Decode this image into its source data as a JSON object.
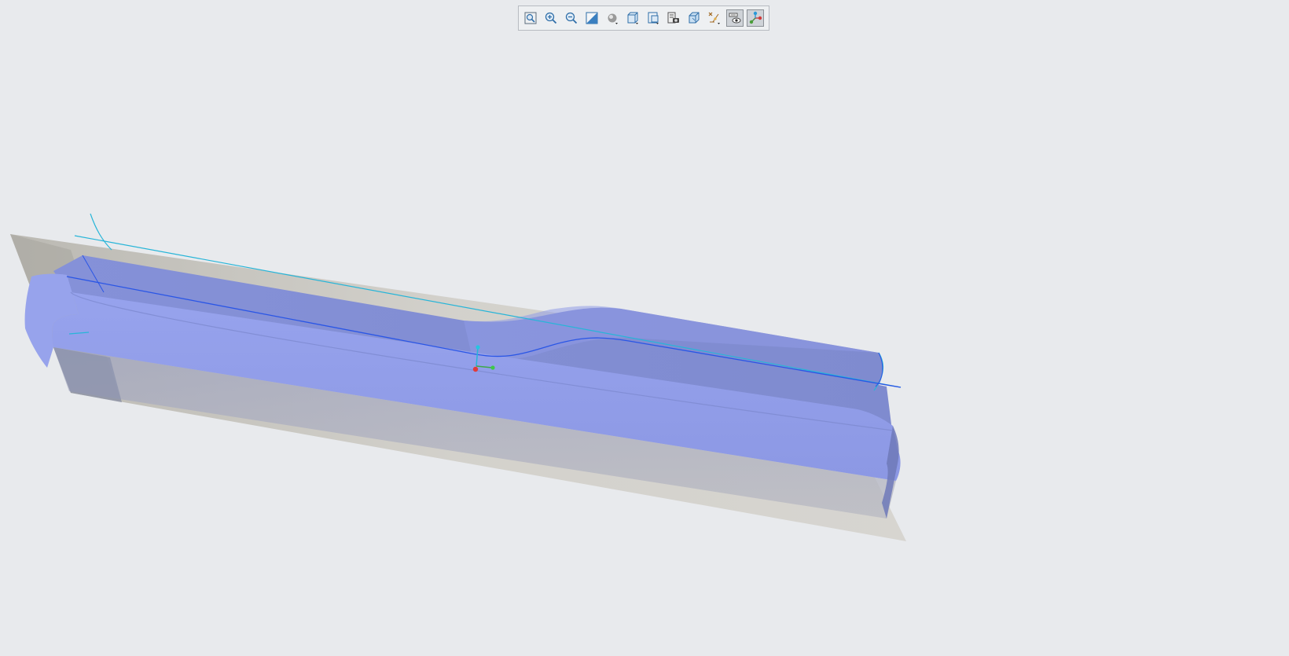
{
  "viewport": {
    "background": "#e8eaed",
    "model_color": "#8e9ae6",
    "model_shadow_color": "#7f8bd0",
    "plane_color": "#d1cfc9",
    "curve_color": "#27b5d8",
    "edge_color": "#2a56e6"
  },
  "toolbar": {
    "buttons": [
      {
        "name": "refit-icon",
        "icon": "refit"
      },
      {
        "name": "zoom-in-icon",
        "icon": "zoom-in"
      },
      {
        "name": "zoom-out-icon",
        "icon": "zoom-out"
      },
      {
        "name": "repaint-icon",
        "icon": "repaint"
      },
      {
        "name": "display-style-icon",
        "icon": "display-style"
      },
      {
        "name": "saved-orientations-icon",
        "icon": "saved-orientations"
      },
      {
        "name": "view-manager-icon",
        "icon": "view-manager"
      },
      {
        "name": "perspective-view-icon",
        "icon": "perspective-view"
      },
      {
        "name": "section-view-icon",
        "icon": "section-view"
      },
      {
        "name": "datum-display-filters-icon",
        "icon": "datum-display-filters"
      },
      {
        "name": "annotation-display-icon",
        "icon": "annotation-display",
        "active": true
      },
      {
        "name": "spin-center-icon",
        "icon": "spin-center",
        "active": true
      }
    ]
  }
}
